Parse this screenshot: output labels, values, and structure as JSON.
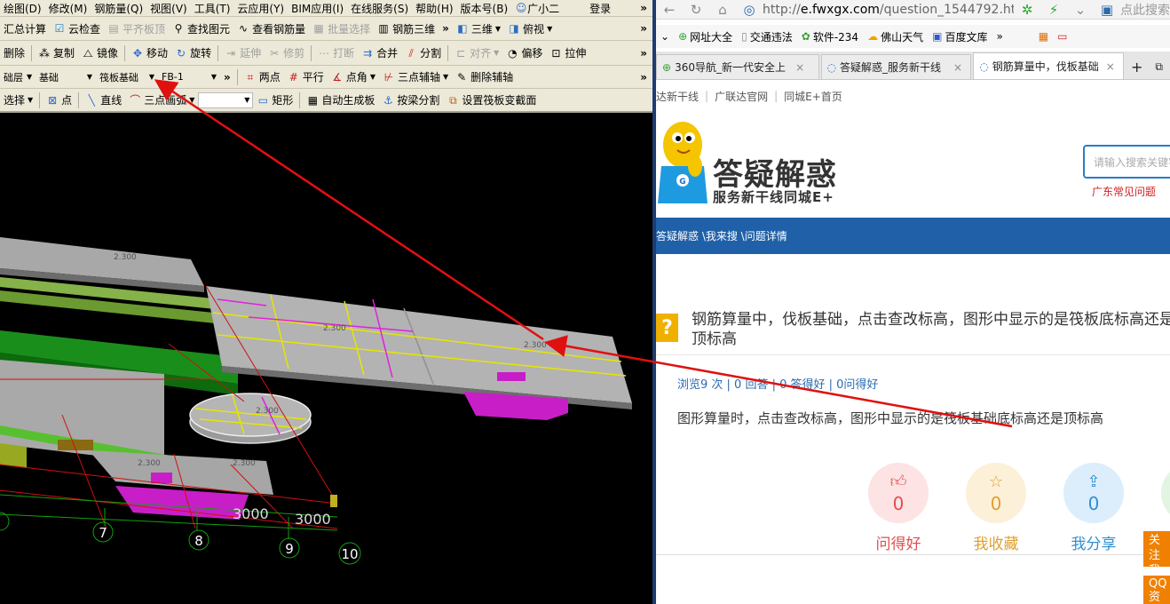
{
  "cad": {
    "menu": [
      "绘图(D)",
      "修改(M)",
      "钢筋量(Q)",
      "视图(V)",
      "工具(T)",
      "云应用(Y)",
      "BIM应用(I)",
      "在线服务(S)",
      "帮助(H)",
      "版本号(B)",
      "广小二",
      "登录"
    ],
    "toolbar1": [
      "汇总计算",
      "云检查",
      "平齐板顶",
      "查找图元",
      "查看钢筋量",
      "批量选择",
      "钢筋三维",
      "三维",
      "俯视"
    ],
    "toolbar2": [
      "删除",
      "复制",
      "镜像",
      "移动",
      "旋转",
      "延伸",
      "修剪",
      "打断",
      "合并",
      "分割",
      "对齐",
      "偏移",
      "拉伸"
    ],
    "toolbar3": {
      "layer": "础层",
      "category": "基础",
      "element_type": "筏板基础",
      "element_name": "FB-1",
      "tools": [
        "两点",
        "平行",
        "点角",
        "三点辅轴",
        "删除辅轴"
      ]
    },
    "toolbar4": [
      "选择",
      "点",
      "直线",
      "三点画弧",
      "矩形",
      "自动生成板",
      "按梁分割",
      "设置筏板变截面"
    ],
    "viewport": {
      "dims": [
        "2.300",
        "2.300",
        "2.300",
        "2.300",
        "2.300",
        "2.300"
      ],
      "axis_labels": [
        "7",
        "8",
        "9",
        "10"
      ],
      "spacing": [
        "3000",
        "3000"
      ]
    }
  },
  "browser": {
    "url_prefix": "http://",
    "url_host": "e.fwxgx.com",
    "url_path": "/question_1544792.html",
    "search_hint": "点此搜索",
    "bookmarks": [
      "网址大全",
      "交通违法",
      "软件-234",
      "佛山天气",
      "百度文库"
    ],
    "tabs": [
      "360导航_新一代安全上",
      "答疑解惑_服务新干线",
      "钢筋算量中，伐板基础"
    ],
    "topnav": [
      "达新干线",
      "广联达官网",
      "同城E+首页"
    ],
    "logo_title": "答疑解惑",
    "logo_sub": "服务新干线同城E+",
    "search_placeholder": "请输入搜索关键字",
    "hot_link": "广东常见问题",
    "breadcrumb": "答疑解惑 \\我来搜 \\问题详情",
    "question_title": "钢筋算量中，伐板基础，点击查改标高，图形中显示的是筏板底标高还是顶标高",
    "stats": "浏览9 次 | 0 回答 | 0 答得好 | 0问得好",
    "question_body": "图形算量时，点击查改标高，图形中显示的是筏板基础底标高还是顶标高",
    "actions": [
      {
        "label": "问得好",
        "count": "0",
        "color": "#e05050"
      },
      {
        "label": "我收藏",
        "count": "0",
        "color": "#e0a030"
      },
      {
        "label": "我分享",
        "count": "0",
        "color": "#3090d0"
      }
    ],
    "side_follow": "关注我们",
    "side_qq": "QQ资讯"
  }
}
